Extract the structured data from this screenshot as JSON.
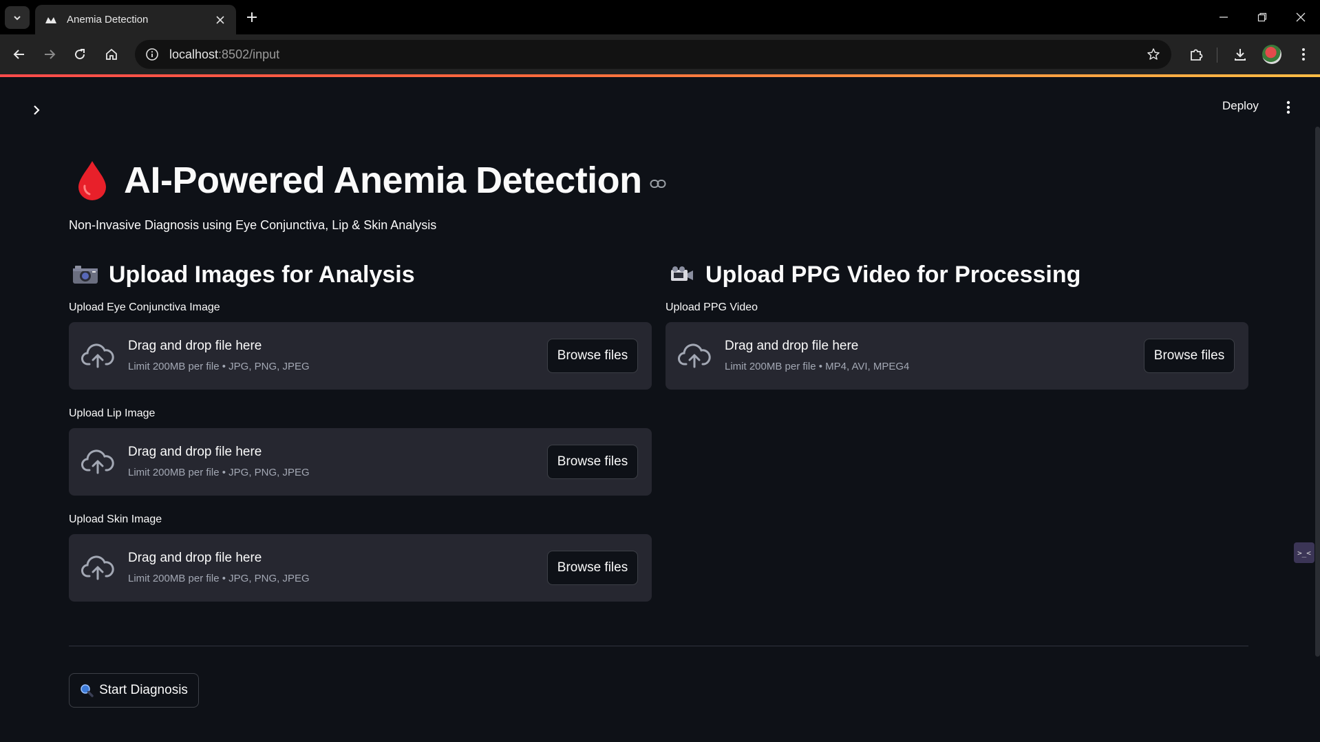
{
  "browser": {
    "tab_title": "Anemia Detection",
    "url_host": "localhost",
    "url_rest": ":8502/input"
  },
  "app": {
    "deploy_label": "Deploy",
    "title": "AI-Powered Anemia Detection",
    "subtitle": "Non-Invasive Diagnosis using Eye Conjunctiva, Lip & Skin Analysis",
    "images_section": {
      "heading": "Upload Images for Analysis",
      "uploaders": [
        {
          "label": "Upload Eye Conjunctiva Image",
          "drop_text": "Drag and drop file here",
          "limit": "Limit 200MB per file • JPG, PNG, JPEG",
          "button": "Browse files"
        },
        {
          "label": "Upload Lip Image",
          "drop_text": "Drag and drop file here",
          "limit": "Limit 200MB per file • JPG, PNG, JPEG",
          "button": "Browse files"
        },
        {
          "label": "Upload Skin Image",
          "drop_text": "Drag and drop file here",
          "limit": "Limit 200MB per file • JPG, PNG, JPEG",
          "button": "Browse files"
        }
      ]
    },
    "video_section": {
      "heading": "Upload PPG Video for Processing",
      "uploader": {
        "label": "Upload PPG Video",
        "drop_text": "Drag and drop file here",
        "limit": "Limit 200MB per file • MP4, AVI, MPEG4",
        "button": "Browse files"
      }
    },
    "start_button": "Start Diagnosis",
    "side_widget": ">_<"
  },
  "colors": {
    "background": "#0e1117",
    "dropzone": "#262730",
    "accent_red": "#ff4b4b"
  },
  "icons": [
    "tab-search-icon",
    "streamlit-favicon-icon",
    "close-icon",
    "plus-icon",
    "minimize-icon",
    "restore-icon",
    "window-close-icon",
    "back-icon",
    "forward-icon",
    "reload-icon",
    "home-icon",
    "site-info-icon",
    "star-icon",
    "extensions-icon",
    "download-icon",
    "chrome-menu-icon",
    "chevron-right-icon",
    "kebab-menu-icon",
    "blood-drop-icon",
    "link-icon",
    "camera-icon",
    "video-camera-icon",
    "cloud-upload-icon",
    "magnifier-icon"
  ]
}
